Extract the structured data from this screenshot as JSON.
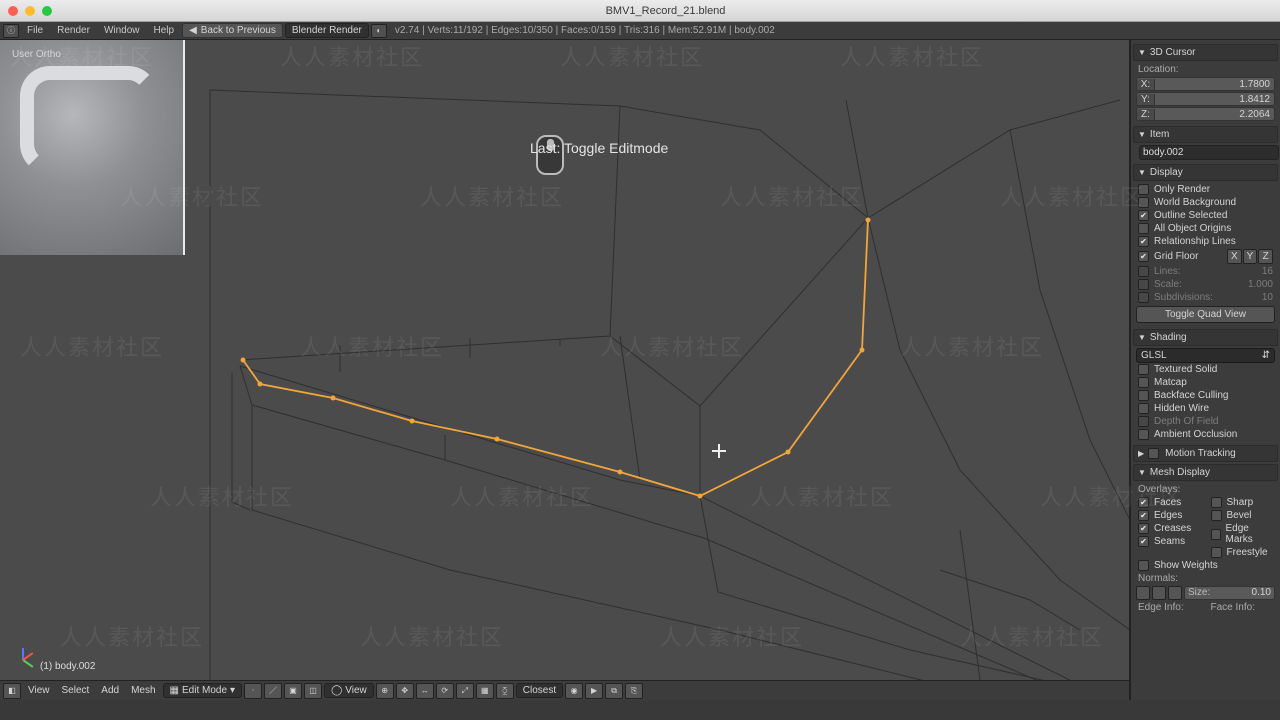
{
  "title": "BMV1_Record_21.blend",
  "menus": {
    "file": "File",
    "render": "Render",
    "window": "Window",
    "help": "Help"
  },
  "back_prev": "Back to Previous",
  "renderer": "Blender Render",
  "stats": "v2.74 | Verts:11/192 | Edges:10/350 | Faces:0/159 | Tris:316 | Mem:52.91M | body.002",
  "viewport": {
    "proj": "User Ortho",
    "last_op": "Last: Toggle Editmode",
    "obj": "(1) body.002"
  },
  "viewhdr": {
    "view": "View",
    "select": "Select",
    "add": "Add",
    "mesh": "Mesh",
    "mode": "Edit Mode",
    "snap": "Closest",
    "vlbl": "View"
  },
  "panel": {
    "cursor": {
      "title": "3D Cursor",
      "loc": "Location:",
      "x": "1.7800",
      "y": "1.8412",
      "z": "2.2064"
    },
    "item": {
      "title": "Item",
      "name": "body.002"
    },
    "display": {
      "title": "Display",
      "only_render": "Only Render",
      "world_bg": "World Background",
      "outline_sel": "Outline Selected",
      "all_origins": "All Object Origins",
      "rel_lines": "Relationship Lines",
      "grid_floor": "Grid Floor",
      "lines": "Lines:",
      "lines_v": "16",
      "scale": "Scale:",
      "scale_v": "1.000",
      "subdiv": "Subdivisions:",
      "subdiv_v": "10",
      "toggle_quad": "Toggle Quad View"
    },
    "shading": {
      "title": "Shading",
      "mode": "GLSL",
      "tex_solid": "Textured Solid",
      "matcap": "Matcap",
      "backface": "Backface Culling",
      "hidden_wire": "Hidden Wire",
      "dof": "Depth Of Field",
      "ao": "Ambient Occlusion"
    },
    "motion": "Motion Tracking",
    "meshdisp": {
      "title": "Mesh Display",
      "overlays": "Overlays:",
      "faces": "Faces",
      "sharp": "Sharp",
      "edges": "Edges",
      "bevel": "Bevel",
      "creases": "Creases",
      "edge_marks": "Edge Marks",
      "seams": "Seams",
      "freestyle": "Freestyle",
      "show_weights": "Show Weights",
      "normals": "Normals:",
      "size": "Size:",
      "size_v": "0.10",
      "edge_info": "Edge Info:",
      "face_info": "Face Info:"
    }
  },
  "watermark": "人人素材社区"
}
